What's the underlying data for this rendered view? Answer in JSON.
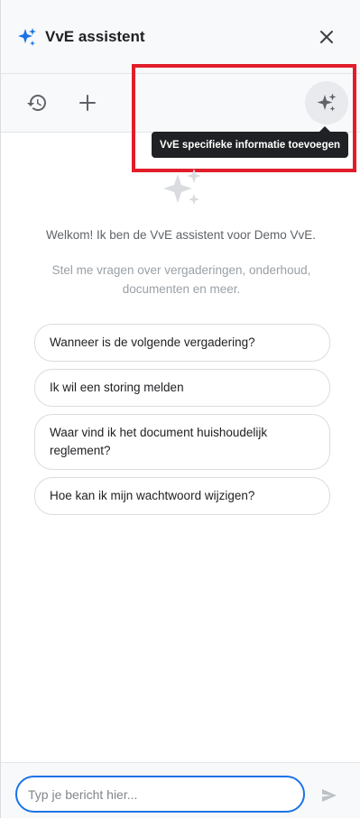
{
  "header": {
    "title": "VvE assistent",
    "logo_icon": "sparkle-icon",
    "close_icon": "close-icon"
  },
  "toolbar": {
    "history_icon": "history-icon",
    "add_icon": "plus-icon",
    "info_icon": "sparkle-icon",
    "tooltip": "VvE specifieke informatie toevoegen"
  },
  "main": {
    "welcome": "Welkom! Ik ben de VvE assistent voor Demo VvE.",
    "subtext": "Stel me vragen over vergaderingen, onderhoud, documenten en meer.",
    "suggestions": [
      "Wanneer is de volgende vergadering?",
      "Ik wil een storing melden",
      "Waar vind ik het document huishoudelijk reglement?",
      "Hoe kan ik mijn wachtwoord wijzigen?"
    ]
  },
  "footer": {
    "input_placeholder": "Typ je bericht hier...",
    "send_icon": "send-icon"
  },
  "colors": {
    "accent": "#1a73e8",
    "highlight": "#e11d2a",
    "tooltip_bg": "#202124",
    "panel_bg": "#f8f9fa"
  }
}
